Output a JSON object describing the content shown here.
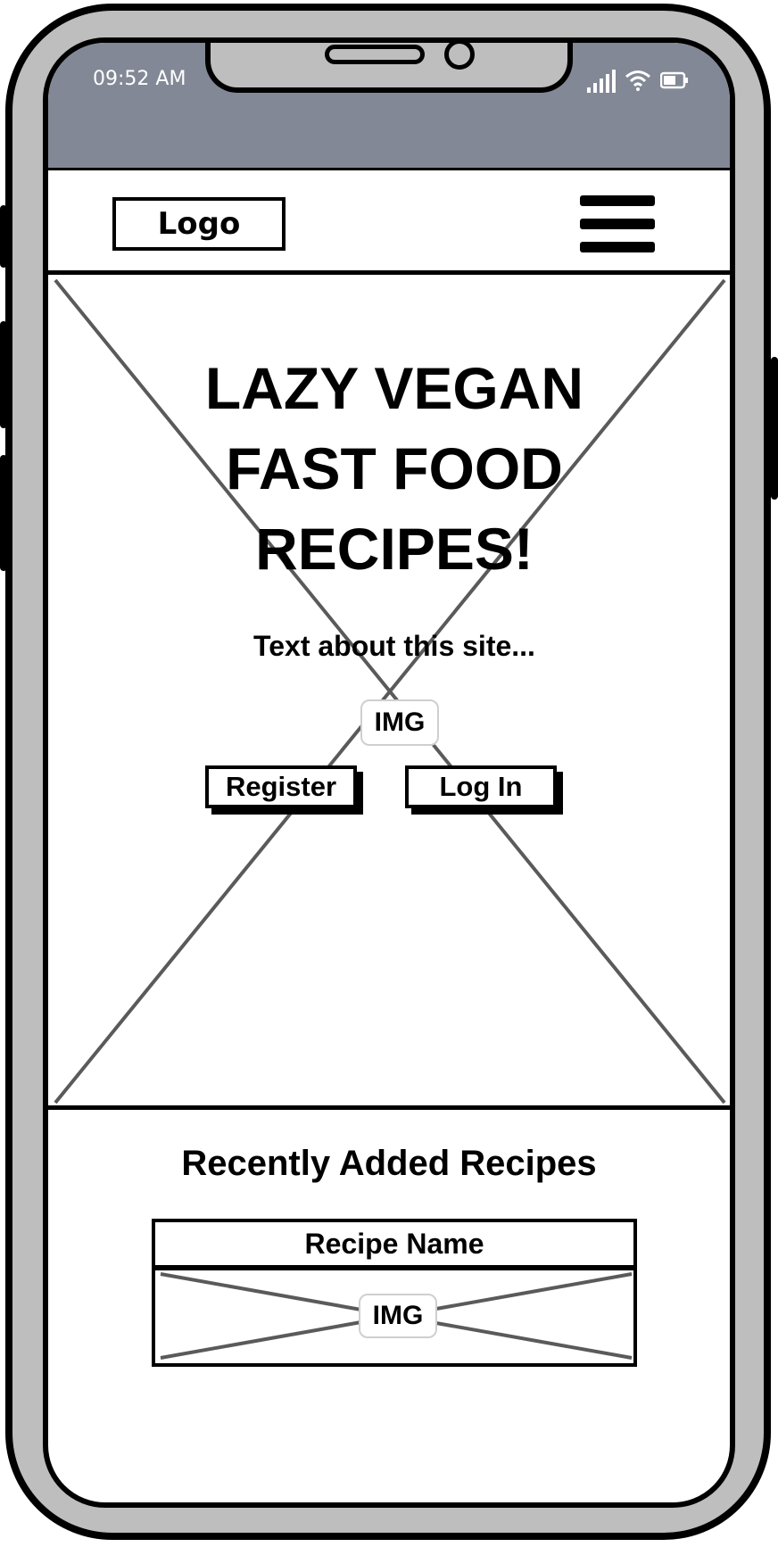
{
  "status_bar": {
    "time": "09:52 AM",
    "icons": [
      "signal-icon",
      "wifi-icon",
      "battery-icon"
    ]
  },
  "header": {
    "logo_label": "Logo",
    "menu_icon": "hamburger-menu-icon"
  },
  "hero": {
    "title_line_1": "LAZY VEGAN",
    "title_line_2": "FAST FOOD",
    "title_line_3": "RECIPES!",
    "text": "Text about this site...",
    "image_placeholder": "IMG",
    "register_label": "Register",
    "login_label": "Log In"
  },
  "recent": {
    "title": "Recently Added Recipes",
    "card": {
      "name": "Recipe Name",
      "image_placeholder": "IMG"
    }
  },
  "colors": {
    "frame": "#bebebe",
    "status_bar": "#828895",
    "outline": "#000000",
    "placeholder_cross": "#5a5a5a"
  }
}
